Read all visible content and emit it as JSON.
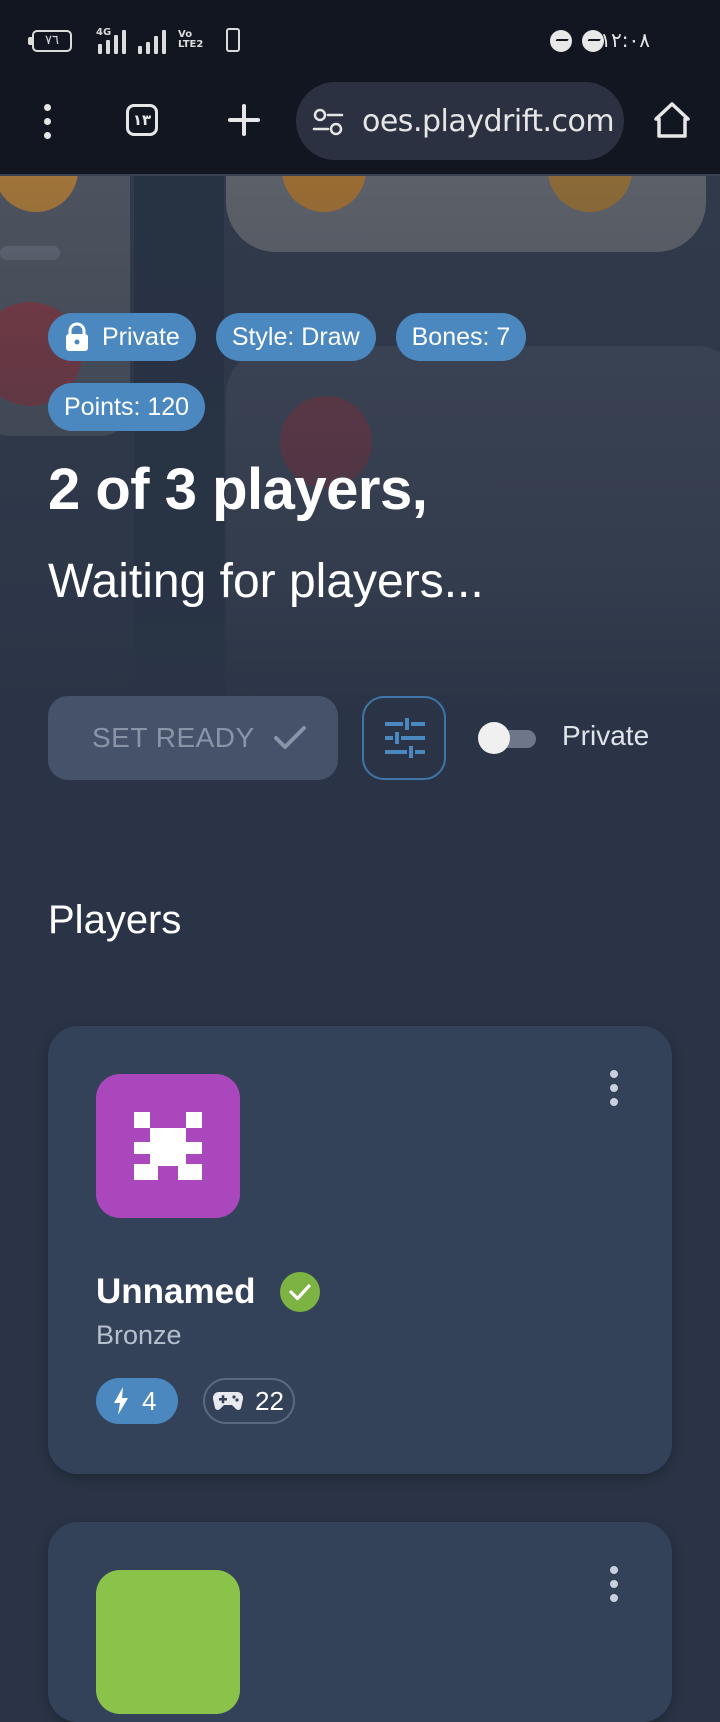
{
  "status_bar": {
    "battery": "٧٦",
    "network_1": "4G",
    "network_2": "Vo LTE2",
    "time": "١٢:٠٨"
  },
  "browser": {
    "tab_count": "١٣",
    "url": "oes.playdrift.com"
  },
  "lobby": {
    "badges": {
      "private": "Private",
      "style": "Style: Draw",
      "bones": "Bones: 7",
      "points": "Points: 120"
    },
    "title": "2 of 3 players,",
    "subtitle": "Waiting for players...",
    "set_ready_label": "SET READY",
    "private_toggle_label": "Private",
    "private_toggle_on": false
  },
  "players": {
    "heading": "Players",
    "list": [
      {
        "name": "Unnamed",
        "rank": "Bronze",
        "energy": "4",
        "games": "22",
        "verified": true,
        "avatar_color": "#ab47bc"
      },
      {
        "avatar_color": "#8bc34a"
      }
    ]
  },
  "colors": {
    "accent": "#4a88bf",
    "background": "#2a3446",
    "card": "#344259",
    "success": "#7cb342"
  }
}
